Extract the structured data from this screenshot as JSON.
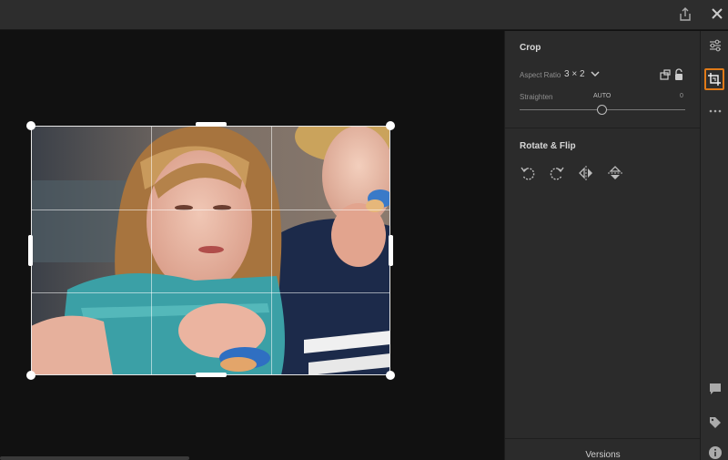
{
  "panel": {
    "crop_title": "Crop",
    "aspect_ratio_label": "Aspect Ratio",
    "aspect_ratio_value": "3 × 2",
    "straighten_label": "Straighten",
    "straighten_mode": "AUTO",
    "straighten_value": "0",
    "rotate_flip_title": "Rotate & Flip",
    "versions_label": "Versions"
  },
  "icons": {
    "topbar": [
      "share-icon",
      "close-icon"
    ],
    "rotate_tools": [
      "rotate-left-icon",
      "rotate-right-icon",
      "flip-horizontal-icon",
      "flip-vertical-icon"
    ],
    "strip": [
      "edit-sliders-icon",
      "crop-icon",
      "more-icon",
      "comment-icon",
      "tag-icon",
      "info-icon"
    ]
  },
  "colors": {
    "active_tool_accent": "#e07a18",
    "panel_bg": "#2b2b2b",
    "canvas_bg": "#111111"
  },
  "slider": {
    "straighten_level": 0.5
  }
}
